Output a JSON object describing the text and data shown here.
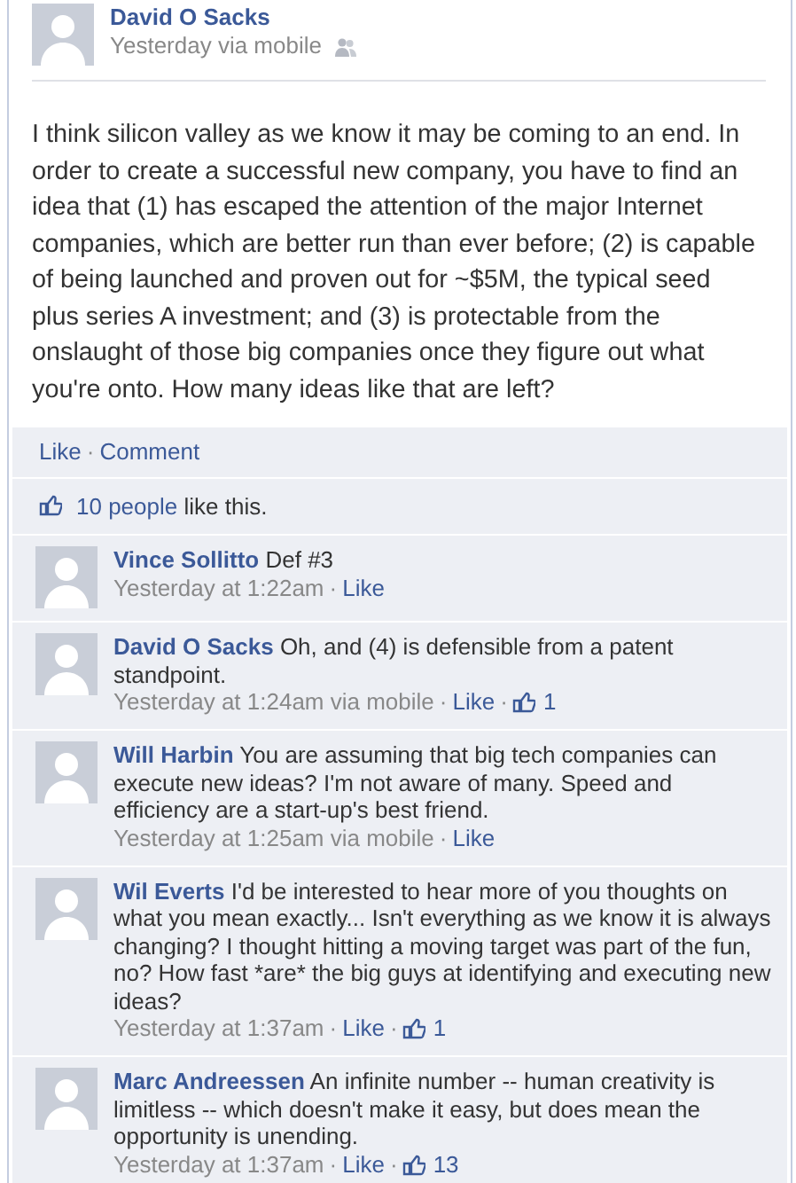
{
  "separator": "·",
  "post": {
    "author": "David O Sacks",
    "meta": "Yesterday via mobile",
    "body": "I think silicon valley as we know it may be coming to an end. In order to create a successful new company, you have to find an idea that (1) has escaped the attention of the major Internet companies, which are better run than ever before; (2) is capable of being launched and proven out for ~$5M, the typical seed plus series A investment; and (3) is protectable from the onslaught of those big companies once they figure out what you're onto. How many ideas like that are left?"
  },
  "actions": [
    "Like",
    "Comment"
  ],
  "likes": {
    "people": "10 people",
    "rest": "like this."
  },
  "comments": [
    {
      "author": "Vince Sollitto",
      "text": "Def #3",
      "time": "Yesterday at 1:22am",
      "like": "Like"
    },
    {
      "author": "David O Sacks",
      "text": "Oh, and (4) is defensible from a patent standpoint.",
      "time": "Yesterday at 1:24am via mobile",
      "like": "Like",
      "like_count": "1"
    },
    {
      "author": "Will Harbin",
      "text": "You are assuming that big tech companies can execute new ideas? I'm not aware of many. Speed and efficiency are a start-up's best friend.",
      "time": "Yesterday at 1:25am via mobile",
      "like": "Like"
    },
    {
      "author": "Wil Everts",
      "text": "I'd be interested to hear more of you thoughts on what you mean exactly... Isn't everything as we know it is always changing? I thought hitting a moving target was part of the fun, no? How fast *are* the big guys at identifying and executing new ideas?",
      "time": "Yesterday at 1:37am",
      "like": "Like",
      "like_count": "1"
    },
    {
      "author": "Marc Andreessen",
      "text": "An infinite number -- human creativity is limitless -- which doesn't make it easy, but does mean the opportunity is unending.",
      "time": "Yesterday at 1:37am",
      "like": "Like",
      "like_count": "13"
    }
  ]
}
